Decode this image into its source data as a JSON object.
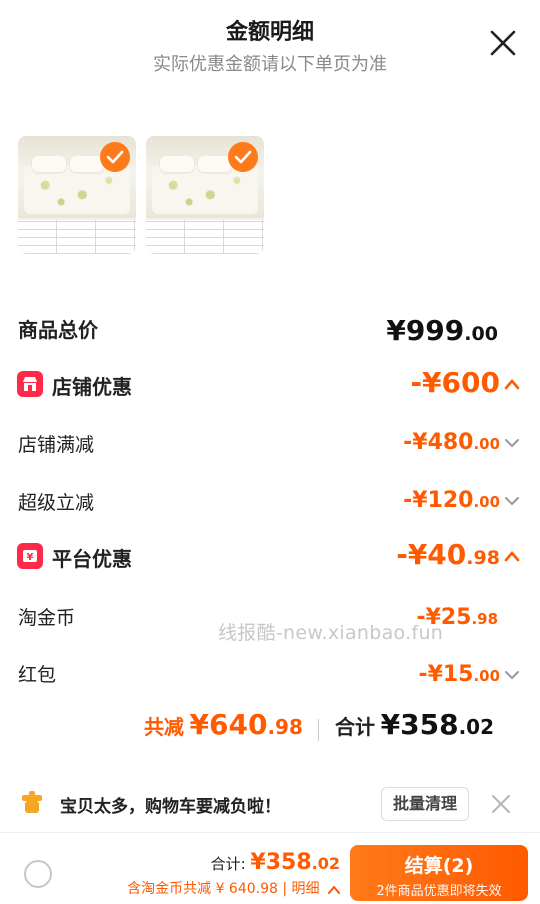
{
  "header": {
    "title": "金额明细",
    "subtitle": "实际优惠金额请以下单页为准"
  },
  "items_total": {
    "label": "商品总价",
    "currency": "¥",
    "int": "999",
    "dec": ".00"
  },
  "store_discount": {
    "label": "店铺优惠",
    "amount": "-¥600",
    "rows": [
      {
        "label": "店铺满减",
        "int": "-¥480",
        "dec": ".00"
      },
      {
        "label": "超级立减",
        "int": "-¥120",
        "dec": ".00"
      }
    ]
  },
  "platform_discount": {
    "label": "平台优惠",
    "int": "-¥40",
    "dec": ".98",
    "rows": [
      {
        "label": "淘金币",
        "int": "-¥25",
        "dec": ".98"
      },
      {
        "label": "红包",
        "int": "-¥15",
        "dec": ".00"
      }
    ]
  },
  "summary": {
    "reduce_label": "共减",
    "reduce_int": "¥640",
    "reduce_dec": ".98",
    "total_label": "合计",
    "total_int": "¥358",
    "total_dec": ".02"
  },
  "watermark": "线报酷-new.xianbao.fun",
  "notice": {
    "text": "宝贝太多，购物车要减负啦！",
    "button": "批量清理"
  },
  "footer": {
    "sum_label": "合计:",
    "sum_int": "¥358",
    "sum_dec": ".02",
    "detail": "含淘金币共减 ¥ 640.98 | 明细",
    "checkout_label": "结算(2)",
    "checkout_sub": "2件商品优惠即将失效"
  },
  "colors": {
    "accent": "#ff5a00",
    "badge": "#ff2a4a",
    "check": "#ff7a1a"
  }
}
